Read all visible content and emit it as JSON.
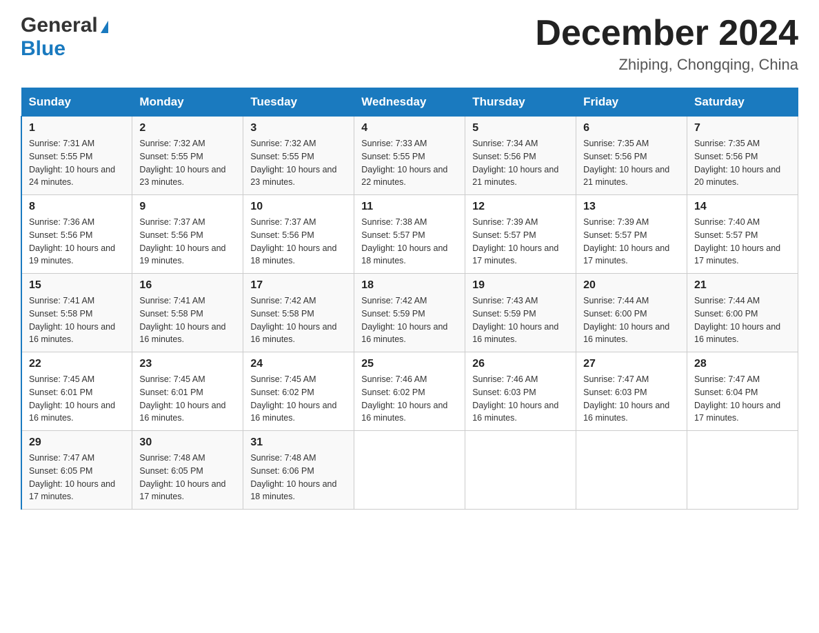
{
  "header": {
    "logo_general": "General",
    "logo_blue": "Blue",
    "title": "December 2024",
    "subtitle": "Zhiping, Chongqing, China"
  },
  "columns": [
    "Sunday",
    "Monday",
    "Tuesday",
    "Wednesday",
    "Thursday",
    "Friday",
    "Saturday"
  ],
  "weeks": [
    [
      {
        "day": "1",
        "sunrise": "7:31 AM",
        "sunset": "5:55 PM",
        "daylight": "10 hours and 24 minutes."
      },
      {
        "day": "2",
        "sunrise": "7:32 AM",
        "sunset": "5:55 PM",
        "daylight": "10 hours and 23 minutes."
      },
      {
        "day": "3",
        "sunrise": "7:32 AM",
        "sunset": "5:55 PM",
        "daylight": "10 hours and 23 minutes."
      },
      {
        "day": "4",
        "sunrise": "7:33 AM",
        "sunset": "5:55 PM",
        "daylight": "10 hours and 22 minutes."
      },
      {
        "day": "5",
        "sunrise": "7:34 AM",
        "sunset": "5:56 PM",
        "daylight": "10 hours and 21 minutes."
      },
      {
        "day": "6",
        "sunrise": "7:35 AM",
        "sunset": "5:56 PM",
        "daylight": "10 hours and 21 minutes."
      },
      {
        "day": "7",
        "sunrise": "7:35 AM",
        "sunset": "5:56 PM",
        "daylight": "10 hours and 20 minutes."
      }
    ],
    [
      {
        "day": "8",
        "sunrise": "7:36 AM",
        "sunset": "5:56 PM",
        "daylight": "10 hours and 19 minutes."
      },
      {
        "day": "9",
        "sunrise": "7:37 AM",
        "sunset": "5:56 PM",
        "daylight": "10 hours and 19 minutes."
      },
      {
        "day": "10",
        "sunrise": "7:37 AM",
        "sunset": "5:56 PM",
        "daylight": "10 hours and 18 minutes."
      },
      {
        "day": "11",
        "sunrise": "7:38 AM",
        "sunset": "5:57 PM",
        "daylight": "10 hours and 18 minutes."
      },
      {
        "day": "12",
        "sunrise": "7:39 AM",
        "sunset": "5:57 PM",
        "daylight": "10 hours and 17 minutes."
      },
      {
        "day": "13",
        "sunrise": "7:39 AM",
        "sunset": "5:57 PM",
        "daylight": "10 hours and 17 minutes."
      },
      {
        "day": "14",
        "sunrise": "7:40 AM",
        "sunset": "5:57 PM",
        "daylight": "10 hours and 17 minutes."
      }
    ],
    [
      {
        "day": "15",
        "sunrise": "7:41 AM",
        "sunset": "5:58 PM",
        "daylight": "10 hours and 16 minutes."
      },
      {
        "day": "16",
        "sunrise": "7:41 AM",
        "sunset": "5:58 PM",
        "daylight": "10 hours and 16 minutes."
      },
      {
        "day": "17",
        "sunrise": "7:42 AM",
        "sunset": "5:58 PM",
        "daylight": "10 hours and 16 minutes."
      },
      {
        "day": "18",
        "sunrise": "7:42 AM",
        "sunset": "5:59 PM",
        "daylight": "10 hours and 16 minutes."
      },
      {
        "day": "19",
        "sunrise": "7:43 AM",
        "sunset": "5:59 PM",
        "daylight": "10 hours and 16 minutes."
      },
      {
        "day": "20",
        "sunrise": "7:44 AM",
        "sunset": "6:00 PM",
        "daylight": "10 hours and 16 minutes."
      },
      {
        "day": "21",
        "sunrise": "7:44 AM",
        "sunset": "6:00 PM",
        "daylight": "10 hours and 16 minutes."
      }
    ],
    [
      {
        "day": "22",
        "sunrise": "7:45 AM",
        "sunset": "6:01 PM",
        "daylight": "10 hours and 16 minutes."
      },
      {
        "day": "23",
        "sunrise": "7:45 AM",
        "sunset": "6:01 PM",
        "daylight": "10 hours and 16 minutes."
      },
      {
        "day": "24",
        "sunrise": "7:45 AM",
        "sunset": "6:02 PM",
        "daylight": "10 hours and 16 minutes."
      },
      {
        "day": "25",
        "sunrise": "7:46 AM",
        "sunset": "6:02 PM",
        "daylight": "10 hours and 16 minutes."
      },
      {
        "day": "26",
        "sunrise": "7:46 AM",
        "sunset": "6:03 PM",
        "daylight": "10 hours and 16 minutes."
      },
      {
        "day": "27",
        "sunrise": "7:47 AM",
        "sunset": "6:03 PM",
        "daylight": "10 hours and 16 minutes."
      },
      {
        "day": "28",
        "sunrise": "7:47 AM",
        "sunset": "6:04 PM",
        "daylight": "10 hours and 17 minutes."
      }
    ],
    [
      {
        "day": "29",
        "sunrise": "7:47 AM",
        "sunset": "6:05 PM",
        "daylight": "10 hours and 17 minutes."
      },
      {
        "day": "30",
        "sunrise": "7:48 AM",
        "sunset": "6:05 PM",
        "daylight": "10 hours and 17 minutes."
      },
      {
        "day": "31",
        "sunrise": "7:48 AM",
        "sunset": "6:06 PM",
        "daylight": "10 hours and 18 minutes."
      },
      null,
      null,
      null,
      null
    ]
  ],
  "labels": {
    "sunrise": "Sunrise:",
    "sunset": "Sunset:",
    "daylight": "Daylight:"
  }
}
